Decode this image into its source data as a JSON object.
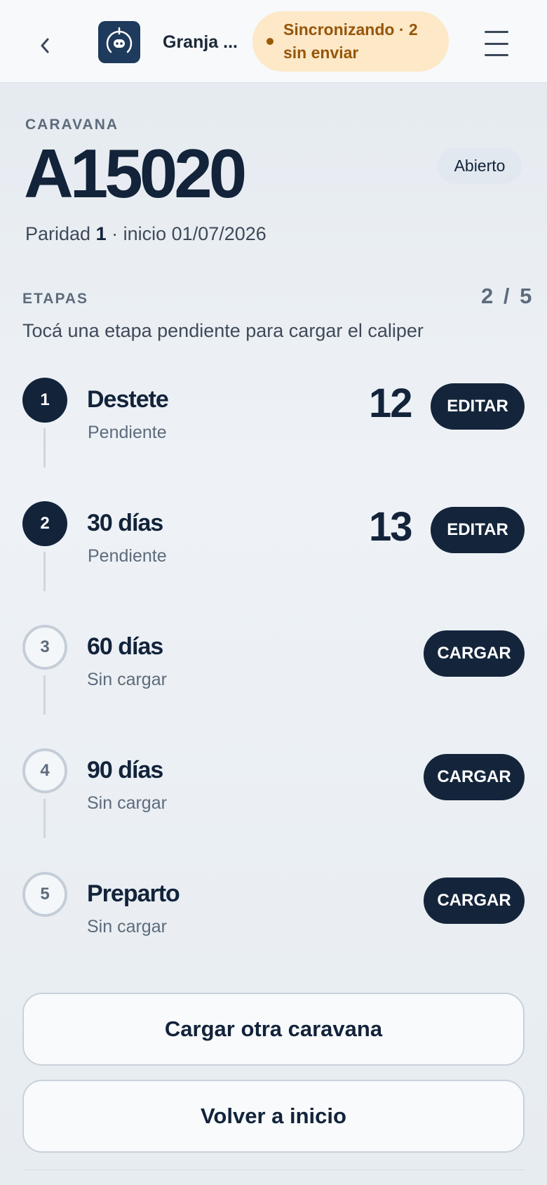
{
  "header": {
    "farm_name": "Granja ...",
    "sync_status": "Sincronizando · 2 sin enviar"
  },
  "animal": {
    "eyebrow": "CARAVANA",
    "id": "A15020",
    "status": "Abierto",
    "parity_label": "Paridad",
    "parity_value": "1",
    "start_text": "· inicio 01/07/2026"
  },
  "stages_section": {
    "title": "ETAPAS",
    "progress": "2 / 5",
    "hint": "Tocá una etapa pendiente para cargar el caliper"
  },
  "stages": [
    {
      "number": "1",
      "name": "Destete",
      "status": "Pendiente",
      "value": "12",
      "action": "EDITAR"
    },
    {
      "number": "2",
      "name": "30 días",
      "status": "Pendiente",
      "value": "13",
      "action": "EDITAR"
    },
    {
      "number": "3",
      "name": "60 días",
      "status": "Sin cargar",
      "value": "",
      "action": "CARGAR"
    },
    {
      "number": "4",
      "name": "90 días",
      "status": "Sin cargar",
      "value": "",
      "action": "CARGAR"
    },
    {
      "number": "5",
      "name": "Preparto",
      "status": "Sin cargar",
      "value": "",
      "action": "CARGAR"
    }
  ],
  "actions": {
    "load_another": "Cargar otra caravana",
    "back_home": "Volver a inicio"
  },
  "colors": {
    "primary": "#12233a",
    "sync_bg": "#fde8c8",
    "sync_text": "#96560a"
  }
}
